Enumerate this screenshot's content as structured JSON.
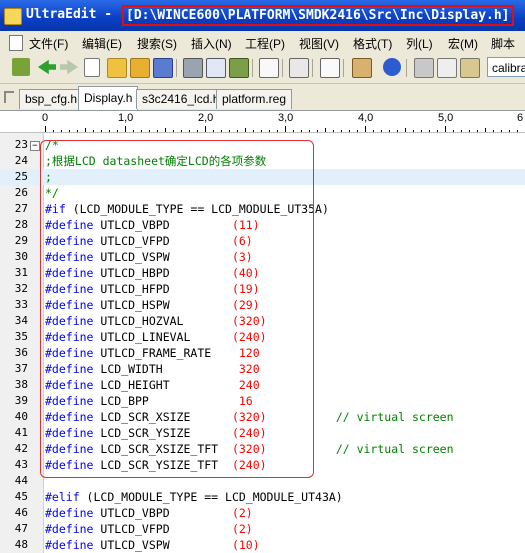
{
  "window": {
    "app_name": "UltraEdit - ",
    "path": "[D:\\WINCE600\\PLATFORM\\SMDK2416\\Src\\Inc\\Display.h]"
  },
  "menu": [
    "文件(F)",
    "编辑(E)",
    "搜索(S)",
    "插入(N)",
    "工程(P)",
    "视图(V)",
    "格式(T)",
    "列(L)",
    "宏(M)",
    "脚本"
  ],
  "toolbar": {
    "font_value": "calibra"
  },
  "tabs": [
    "bsp_cfg.h",
    "Display.h",
    "s3c2416_lcd.h",
    "platform.reg"
  ],
  "active_tab": "Display.h",
  "ruler": {
    "labels": [
      "0",
      "1,0",
      "2,0",
      "3,0",
      "4,0",
      "5,0",
      "6"
    ]
  },
  "lines": [
    {
      "n": "23",
      "fold": "−",
      "parts": [
        {
          "t": "/*",
          "c": "cm"
        }
      ]
    },
    {
      "n": "24",
      "parts": [
        {
          "t": ";根据LCD datasheet确定LCD的各项参数",
          "c": "cm"
        }
      ]
    },
    {
      "n": "25",
      "hl": true,
      "parts": [
        {
          "t": ";",
          "c": "cm"
        }
      ]
    },
    {
      "n": "26",
      "parts": [
        {
          "t": "*/",
          "c": "cm"
        }
      ]
    },
    {
      "n": "27",
      "parts": [
        {
          "t": "#if",
          "c": "kw"
        },
        {
          "t": " (LCD_MODULE_TYPE == LCD_MODULE_UT35A)",
          "c": "pl"
        }
      ]
    },
    {
      "n": "28",
      "parts": [
        {
          "t": "#define",
          "c": "kw"
        },
        {
          "t": " UTLCD_VBPD         ",
          "c": "pl"
        },
        {
          "t": "(11)",
          "c": "num"
        }
      ]
    },
    {
      "n": "29",
      "parts": [
        {
          "t": "#define",
          "c": "kw"
        },
        {
          "t": " UTLCD_VFPD         ",
          "c": "pl"
        },
        {
          "t": "(6)",
          "c": "num"
        }
      ]
    },
    {
      "n": "30",
      "parts": [
        {
          "t": "#define",
          "c": "kw"
        },
        {
          "t": " UTLCD_VSPW         ",
          "c": "pl"
        },
        {
          "t": "(3)",
          "c": "num"
        }
      ]
    },
    {
      "n": "31",
      "parts": [
        {
          "t": "#define",
          "c": "kw"
        },
        {
          "t": " UTLCD_HBPD         ",
          "c": "pl"
        },
        {
          "t": "(40)",
          "c": "num"
        }
      ]
    },
    {
      "n": "32",
      "parts": [
        {
          "t": "#define",
          "c": "kw"
        },
        {
          "t": " UTLCD_HFPD         ",
          "c": "pl"
        },
        {
          "t": "(19)",
          "c": "num"
        }
      ]
    },
    {
      "n": "33",
      "parts": [
        {
          "t": "#define",
          "c": "kw"
        },
        {
          "t": " UTLCD_HSPW         ",
          "c": "pl"
        },
        {
          "t": "(29)",
          "c": "num"
        }
      ]
    },
    {
      "n": "34",
      "parts": [
        {
          "t": "#define",
          "c": "kw"
        },
        {
          "t": " UTLCD_HOZVAL       ",
          "c": "pl"
        },
        {
          "t": "(320)",
          "c": "num"
        }
      ]
    },
    {
      "n": "35",
      "parts": [
        {
          "t": "#define",
          "c": "kw"
        },
        {
          "t": " UTLCD_LINEVAL      ",
          "c": "pl"
        },
        {
          "t": "(240)",
          "c": "num"
        }
      ]
    },
    {
      "n": "36",
      "parts": [
        {
          "t": "#define",
          "c": "kw"
        },
        {
          "t": " UTLCD_FRAME_RATE    ",
          "c": "pl"
        },
        {
          "t": "120",
          "c": "num"
        }
      ]
    },
    {
      "n": "37",
      "parts": [
        {
          "t": "#define",
          "c": "kw"
        },
        {
          "t": " LCD_WIDTH           ",
          "c": "pl"
        },
        {
          "t": "320",
          "c": "num"
        }
      ]
    },
    {
      "n": "38",
      "parts": [
        {
          "t": "#define",
          "c": "kw"
        },
        {
          "t": " LCD_HEIGHT          ",
          "c": "pl"
        },
        {
          "t": "240",
          "c": "num"
        }
      ]
    },
    {
      "n": "39",
      "parts": [
        {
          "t": "#define",
          "c": "kw"
        },
        {
          "t": " LCD_BPP             ",
          "c": "pl"
        },
        {
          "t": "16",
          "c": "num"
        }
      ]
    },
    {
      "n": "40",
      "parts": [
        {
          "t": "#define",
          "c": "kw"
        },
        {
          "t": " LCD_SCR_XSIZE      ",
          "c": "pl"
        },
        {
          "t": "(320)",
          "c": "num"
        },
        {
          "t": "          // virtual screen",
          "c": "cm"
        }
      ]
    },
    {
      "n": "41",
      "parts": [
        {
          "t": "#define",
          "c": "kw"
        },
        {
          "t": " LCD_SCR_YSIZE      ",
          "c": "pl"
        },
        {
          "t": "(240)",
          "c": "num"
        }
      ]
    },
    {
      "n": "42",
      "parts": [
        {
          "t": "#define",
          "c": "kw"
        },
        {
          "t": " LCD_SCR_XSIZE_TFT  ",
          "c": "pl"
        },
        {
          "t": "(320)",
          "c": "num"
        },
        {
          "t": "          // virtual screen",
          "c": "cm"
        }
      ]
    },
    {
      "n": "43",
      "parts": [
        {
          "t": "#define",
          "c": "kw"
        },
        {
          "t": " LCD_SCR_YSIZE_TFT  ",
          "c": "pl"
        },
        {
          "t": "(240)",
          "c": "num"
        }
      ]
    },
    {
      "n": "44",
      "parts": []
    },
    {
      "n": "45",
      "parts": [
        {
          "t": "#elif",
          "c": "kw"
        },
        {
          "t": " (LCD_MODULE_TYPE == LCD_MODULE_UT43A)",
          "c": "pl"
        }
      ]
    },
    {
      "n": "46",
      "parts": [
        {
          "t": "#define",
          "c": "kw"
        },
        {
          "t": " UTLCD_VBPD         ",
          "c": "pl"
        },
        {
          "t": "(2)",
          "c": "num"
        }
      ]
    },
    {
      "n": "47",
      "parts": [
        {
          "t": "#define",
          "c": "kw"
        },
        {
          "t": " UTLCD_VFPD         ",
          "c": "pl"
        },
        {
          "t": "(2)",
          "c": "num"
        }
      ]
    },
    {
      "n": "48",
      "parts": [
        {
          "t": "#define",
          "c": "kw"
        },
        {
          "t": " UTLCD_VSPW         ",
          "c": "pl"
        },
        {
          "t": "(10)",
          "c": "num"
        }
      ]
    }
  ]
}
